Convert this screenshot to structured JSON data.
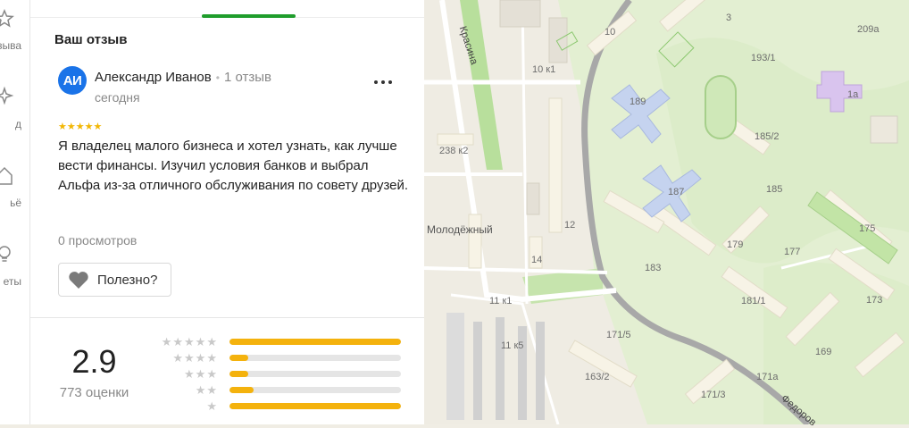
{
  "rail": {
    "items": [
      {
        "label": "зыва"
      },
      {
        "label": "д"
      },
      {
        "label": "ьё"
      },
      {
        "label": "еты"
      }
    ]
  },
  "review": {
    "section_title": "Ваш отзыв",
    "author": {
      "initials": "АИ",
      "name": "Александр Иванов",
      "reviews_count": "1 отзыв",
      "date": "сегодня"
    },
    "rating": 5,
    "stars_text": "★★★★★",
    "text": "Я владелец малого бизнеса и хотел узнать, как лучше вести финансы. Изучил условия банков и выбрал Альфа из-за отличного обслуживания по совету друзей.",
    "views": "0 просмотров",
    "useful_label": "Полезно?"
  },
  "summary": {
    "average": "2.9",
    "count": "773 оценки",
    "distribution": [
      {
        "stars_label": "★★★★★",
        "fraction": 1.0
      },
      {
        "stars_label": "★★★★",
        "fraction": 0.11
      },
      {
        "stars_label": "★★★",
        "fraction": 0.11
      },
      {
        "stars_label": "★★",
        "fraction": 0.14
      },
      {
        "stars_label": "★",
        "fraction": 1.0
      }
    ]
  },
  "map": {
    "labels": [
      {
        "text": "Красина",
        "kind": "street"
      },
      {
        "text": "10",
        "kind": "house"
      },
      {
        "text": "3",
        "kind": "house"
      },
      {
        "text": "209а",
        "kind": "house"
      },
      {
        "text": "10 к1",
        "kind": "house"
      },
      {
        "text": "193/1",
        "kind": "house"
      },
      {
        "text": "189",
        "kind": "house"
      },
      {
        "text": "1а",
        "kind": "house"
      },
      {
        "text": "185/2",
        "kind": "house"
      },
      {
        "text": "238 к2",
        "kind": "house"
      },
      {
        "text": "187",
        "kind": "house"
      },
      {
        "text": "185",
        "kind": "house"
      },
      {
        "text": "Молодёжный",
        "kind": "district"
      },
      {
        "text": "12",
        "kind": "house"
      },
      {
        "text": "175",
        "kind": "house"
      },
      {
        "text": "179",
        "kind": "house"
      },
      {
        "text": "177",
        "kind": "house"
      },
      {
        "text": "14",
        "kind": "house"
      },
      {
        "text": "183",
        "kind": "house"
      },
      {
        "text": "173",
        "kind": "house"
      },
      {
        "text": "11 к1",
        "kind": "house"
      },
      {
        "text": "181/1",
        "kind": "house"
      },
      {
        "text": "171/5",
        "kind": "house"
      },
      {
        "text": "11 к5",
        "kind": "house"
      },
      {
        "text": "169",
        "kind": "house"
      },
      {
        "text": "163/2",
        "kind": "house"
      },
      {
        "text": "171а",
        "kind": "house"
      },
      {
        "text": "171/3",
        "kind": "house"
      },
      {
        "text": "Федоров",
        "kind": "street"
      }
    ]
  }
}
